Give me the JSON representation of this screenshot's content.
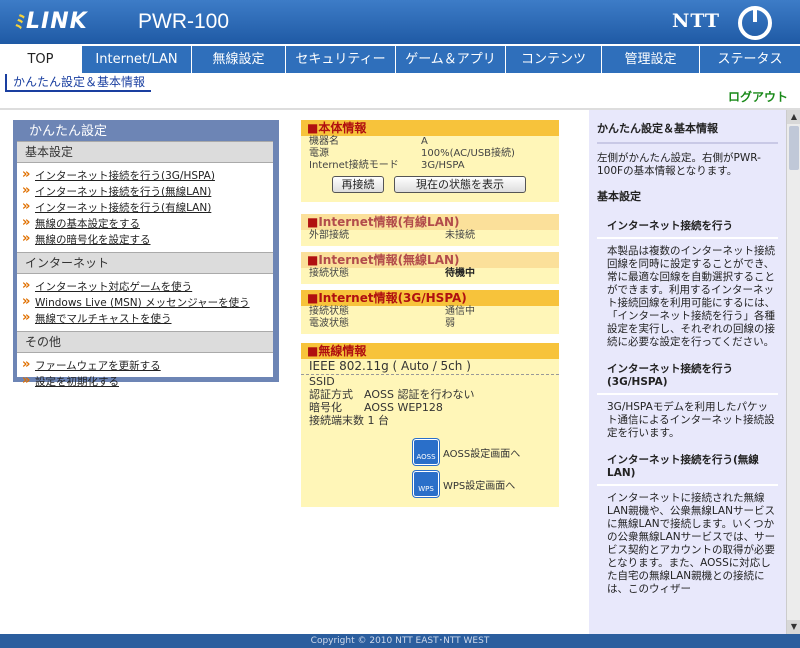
{
  "header": {
    "logo": "LINK",
    "model": "PWR-100",
    "brand": "NTT"
  },
  "nav": {
    "tabs": [
      "TOP",
      "Internet/LAN",
      "無線設定",
      "セキュリティー",
      "ゲーム＆アプリ",
      "コンテンツ",
      "管理設定",
      "ステータス"
    ],
    "active": 0
  },
  "subnav": {
    "label": "かんたん設定＆基本情報"
  },
  "logout": "ログアウト",
  "left": {
    "title": "かんたん設定",
    "sections": [
      {
        "head": "基本設定",
        "items": [
          "インターネット接続を行う(3G/HSPA)",
          "インターネット接続を行う(無線LAN)",
          "インターネット接続を行う(有線LAN)",
          "無線の基本設定をする",
          "無線の暗号化を設定する"
        ]
      },
      {
        "head": "インターネット",
        "items": [
          "インターネット対応ゲームを使う",
          "Windows Live (MSN) メッセンジャーを使う",
          "無線でマルチキャストを使う"
        ]
      },
      {
        "head": "その他",
        "items": [
          "ファームウェアを更新する",
          "設定を初期化する"
        ]
      }
    ]
  },
  "device": {
    "head": "本体情報",
    "rows": [
      [
        "機器名",
        "A"
      ],
      [
        "電源",
        "100%(AC/USB接続)"
      ],
      [
        "Internet接続モード",
        "3G/HSPA"
      ]
    ],
    "btn_reconnect": "再接続",
    "btn_status": "現在の状態を表示"
  },
  "wired": {
    "head": "Internet情報(有線LAN)",
    "rows": [
      [
        "外部接続",
        "未接続"
      ]
    ]
  },
  "wifi_inet": {
    "head": "Internet情報(無線LAN)",
    "rows": [
      [
        "接続状態",
        "待機中"
      ]
    ]
  },
  "hspa": {
    "head": "Internet情報(3G/HSPA)",
    "rows": [
      [
        "接続状態",
        "通信中"
      ],
      [
        "電波状態",
        "弱"
      ]
    ]
  },
  "wireless": {
    "head": "無線情報",
    "standard": "IEEE 802.11g ( Auto / 5ch )",
    "ssid_label": "SSID",
    "auth": "認証方式　AOSS 認証を行わない",
    "enc": "暗号化　　AOSS WEP128",
    "clients": "接続端末数 1 台",
    "aoss_label": "AOSS設定画面へ",
    "wps_label": "WPS設定画面へ",
    "aoss_icon": "AOSS",
    "wps_icon": "WPS"
  },
  "help": {
    "title": "かんたん設定＆基本情報",
    "intro": "左側がかんたん設定。右側がPWR-100Fの基本情報となります。",
    "basic": "基本設定",
    "items": [
      {
        "h": "インターネット接続を行う",
        "p": "本製品は複数のインターネット接続回線を同時に設定することができ、常に最適な回線を自動選択することができます。利用するインターネット接続回線を利用可能にするには、「インターネット接続を行う」各種設定を実行し、それぞれの回線の接続に必要な設定を行ってください。"
      },
      {
        "h": "インターネット接続を行う(3G/HSPA)",
        "p": "3G/HSPAモデムを利用したパケット通信によるインターネット接続設定を行います。"
      },
      {
        "h": "インターネット接続を行う(無線LAN)",
        "p": "インターネットに接続された無線LAN親機や、公衆無線LANサービスに無線LANで接続します。いくつかの公衆無線LANサービスでは、サービス契約とアカウントの取得が必要となります。また、AOSSに対応した自宅の無線LAN親機との接続には、このウィザー"
      }
    ]
  },
  "footer": "Copyright © 2010 NTT EAST･NTT WEST"
}
